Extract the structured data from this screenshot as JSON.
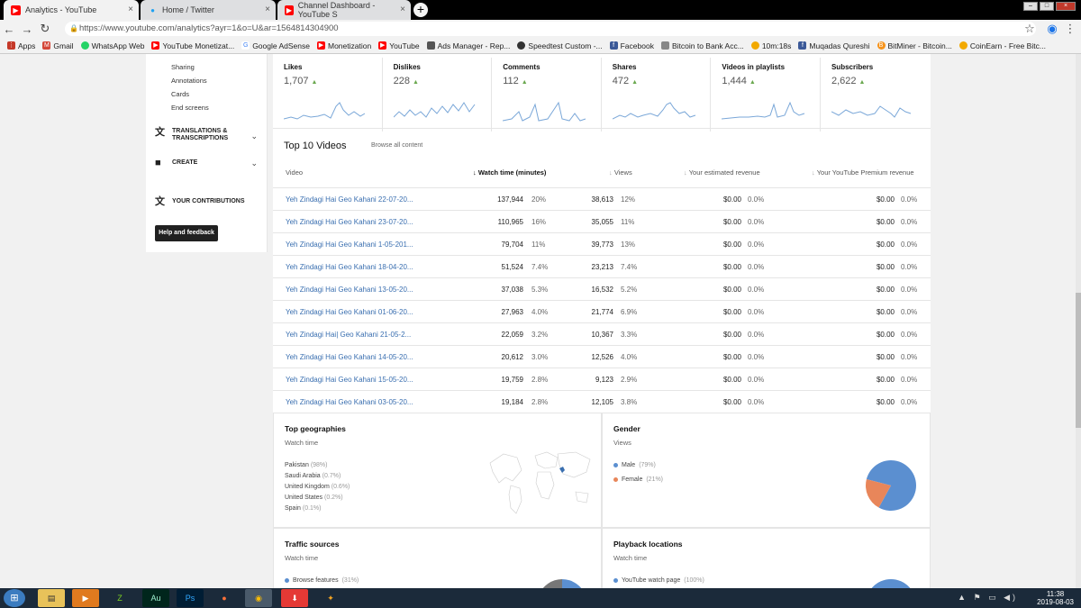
{
  "browser": {
    "tabs": [
      {
        "title": "Analytics - YouTube",
        "icon": "youtube-icon",
        "color": "#ff0000"
      },
      {
        "title": "Home / Twitter",
        "icon": "twitter-icon",
        "color": "#1da1f2"
      },
      {
        "title": "Channel Dashboard - YouTube S",
        "icon": "youtube-icon",
        "color": "#ff0000"
      }
    ],
    "url": "https://www.youtube.com/analytics?ayr=1&o=U&ar=1564814304900",
    "bookmarks": [
      "Apps",
      "Gmail",
      "WhatsApp Web",
      "YouTube Monetizat...",
      "Google AdSense",
      "Monetization",
      "YouTube",
      "Ads Manager - Rep...",
      "Speedtest Custom -...",
      "Facebook",
      "Bitcoin to Bank Acc...",
      "10m:18s",
      "Muqadas Qureshi",
      "BitMiner - Bitcoin...",
      "CoinEarn - Free Bitc..."
    ]
  },
  "sidebar": {
    "subitems": [
      "Sharing",
      "Annotations",
      "Cards",
      "End screens"
    ],
    "translations": "TRANSLATIONS & TRANSCRIPTIONS",
    "create": "CREATE",
    "contributions": "YOUR CONTRIBUTIONS",
    "help": "Help and feedback"
  },
  "metrics": [
    {
      "title": "Likes",
      "value": "1,707"
    },
    {
      "title": "Dislikes",
      "value": "228"
    },
    {
      "title": "Comments",
      "value": "112"
    },
    {
      "title": "Shares",
      "value": "472"
    },
    {
      "title": "Videos in playlists",
      "value": "1,444"
    },
    {
      "title": "Subscribers",
      "value": "2,622"
    }
  ],
  "top_videos": {
    "title": "Top 10 Videos",
    "browse": "Browse all content",
    "columns": {
      "video": "Video",
      "watch_time": "Watch time (minutes)",
      "views": "Views",
      "revenue": "Your estimated revenue",
      "premium": "Your YouTube Premium revenue"
    },
    "rows": [
      {
        "title": "Yeh Zindagi Hai Geo Kahani 22-07-20...",
        "wt": "137,944",
        "wtp": "20%",
        "views": "38,613",
        "vp": "12%",
        "rev": "$0.00",
        "revp": "0.0%",
        "prem": "$0.00",
        "premp": "0.0%"
      },
      {
        "title": "Yeh Zindagi Hai Geo Kahani 23-07-20...",
        "wt": "110,965",
        "wtp": "16%",
        "views": "35,055",
        "vp": "11%",
        "rev": "$0.00",
        "revp": "0.0%",
        "prem": "$0.00",
        "premp": "0.0%"
      },
      {
        "title": "Yeh Zindagi Hai Geo Kahani 1-05-201...",
        "wt": "79,704",
        "wtp": "11%",
        "views": "39,773",
        "vp": "13%",
        "rev": "$0.00",
        "revp": "0.0%",
        "prem": "$0.00",
        "premp": "0.0%"
      },
      {
        "title": "Yeh Zindagi Hai Geo Kahani 18-04-20...",
        "wt": "51,524",
        "wtp": "7.4%",
        "views": "23,213",
        "vp": "7.4%",
        "rev": "$0.00",
        "revp": "0.0%",
        "prem": "$0.00",
        "premp": "0.0%"
      },
      {
        "title": "Yeh Zindagi Hai Geo Kahani 13-05-20...",
        "wt": "37,038",
        "wtp": "5.3%",
        "views": "16,532",
        "vp": "5.2%",
        "rev": "$0.00",
        "revp": "0.0%",
        "prem": "$0.00",
        "premp": "0.0%"
      },
      {
        "title": "Yeh Zindagi Hai Geo Kahani 01-06-20...",
        "wt": "27,963",
        "wtp": "4.0%",
        "views": "21,774",
        "vp": "6.9%",
        "rev": "$0.00",
        "revp": "0.0%",
        "prem": "$0.00",
        "premp": "0.0%"
      },
      {
        "title": "Yeh Zindagi Hai| Geo Kahani 21-05-2...",
        "wt": "22,059",
        "wtp": "3.2%",
        "views": "10,367",
        "vp": "3.3%",
        "rev": "$0.00",
        "revp": "0.0%",
        "prem": "$0.00",
        "premp": "0.0%"
      },
      {
        "title": "Yeh Zindagi Hai Geo Kahani 14-05-20...",
        "wt": "20,612",
        "wtp": "3.0%",
        "views": "12,526",
        "vp": "4.0%",
        "rev": "$0.00",
        "revp": "0.0%",
        "prem": "$0.00",
        "premp": "0.0%"
      },
      {
        "title": "Yeh Zindagi Hai Geo Kahani 15-05-20...",
        "wt": "19,759",
        "wtp": "2.8%",
        "views": "9,123",
        "vp": "2.9%",
        "rev": "$0.00",
        "revp": "0.0%",
        "prem": "$0.00",
        "premp": "0.0%"
      },
      {
        "title": "Yeh Zindagi Hai Geo Kahani 03-05-20...",
        "wt": "19,184",
        "wtp": "2.8%",
        "views": "12,105",
        "vp": "3.8%",
        "rev": "$0.00",
        "revp": "0.0%",
        "prem": "$0.00",
        "premp": "0.0%"
      }
    ]
  },
  "geographies": {
    "title": "Top geographies",
    "subtitle": "Watch time",
    "items": [
      {
        "name": "Pakistan",
        "pct": "(98%)"
      },
      {
        "name": "Saudi Arabia",
        "pct": "(0.7%)"
      },
      {
        "name": "United Kingdom",
        "pct": "(0.6%)"
      },
      {
        "name": "United States",
        "pct": "(0.2%)"
      },
      {
        "name": "Spain",
        "pct": "(0.1%)"
      }
    ]
  },
  "gender": {
    "title": "Gender",
    "subtitle": "Views",
    "items": [
      {
        "name": "Male",
        "pct": "(79%)",
        "value": 79,
        "color": "#5b8fd0"
      },
      {
        "name": "Female",
        "pct": "(21%)",
        "value": 21,
        "color": "#e8865a"
      }
    ]
  },
  "traffic": {
    "title": "Traffic sources",
    "subtitle": "Watch time",
    "first": "Browse features",
    "first_pct": "(31%)"
  },
  "playback": {
    "title": "Playback locations",
    "subtitle": "Watch time",
    "first": "YouTube watch page",
    "first_pct": "(100%)"
  },
  "taskbar": {
    "time": "11:38",
    "date": "2019-08-03"
  },
  "colors": {
    "link": "#3a6fb0",
    "up_arrow": "#6aa84f",
    "spark": "#7aa7d8"
  }
}
